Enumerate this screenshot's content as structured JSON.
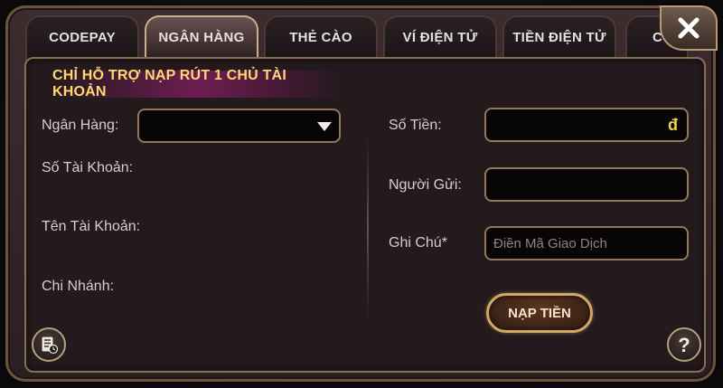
{
  "tabs": [
    {
      "label": "CODEPAY"
    },
    {
      "label": "NGÂN HÀNG"
    },
    {
      "label": "THẺ CÀO"
    },
    {
      "label": "VÍ ĐIỆN TỬ"
    },
    {
      "label": "TIỀN ĐIỆN TỬ"
    },
    {
      "label": "C"
    }
  ],
  "notice": "CHỈ HỖ TRỢ NẠP RÚT 1 CHỦ TÀI KHOẢN",
  "left_form": {
    "bank_label": "Ngân Hàng:",
    "bank_value": "",
    "account_number_label": "Số Tài Khoản:",
    "account_name_label": "Tên Tài Khoản:",
    "branch_label": "Chi Nhánh:"
  },
  "right_form": {
    "amount_label": "Số Tiền:",
    "amount_value": "",
    "currency_symbol": "đ",
    "sender_label": "Người Gửi:",
    "sender_value": "",
    "note_label": "Ghi Chú*",
    "note_placeholder": "Điền Mã Giao Dịch"
  },
  "submit_label": "NẠP TIỀN",
  "icons": {
    "close": "close-icon",
    "history": "history-icon",
    "help": "help-icon",
    "dropdown": "chevron-down-icon"
  },
  "colors": {
    "accent_gold": "#d0a868",
    "notice_text": "#ffd870",
    "currency": "#f2d44b"
  }
}
